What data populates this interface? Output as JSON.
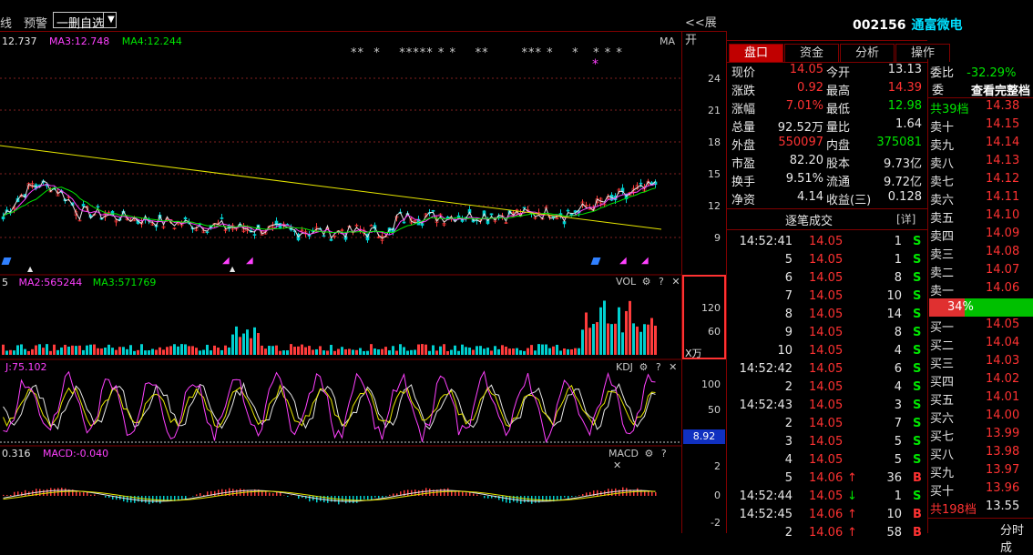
{
  "toolbar": {
    "line_tab": "线",
    "alert": "预警",
    "selector": "一删自选",
    "expand": "<<展开"
  },
  "main_chart": {
    "ma_values": [
      {
        "label": "12.737",
        "color": "#e6e6e6"
      },
      {
        "label": "MA3:12.748",
        "color": "#ff40ff"
      },
      {
        "label": "MA4:12.244",
        "color": "#00e600"
      }
    ],
    "ma_tag": "MA",
    "price_axis": [
      "24",
      "21",
      "18",
      "15",
      "12",
      "9"
    ],
    "price_ticks": [
      24,
      21,
      18,
      15,
      12,
      9
    ],
    "star_marks": "**  *    ***** * *    **       *** *    *   * * *",
    "star_accent": "*"
  },
  "vol_chart": {
    "labels": [
      {
        "label": "5",
        "color": "#e6e6e6"
      },
      {
        "label": "MA2:565244",
        "color": "#ff40ff"
      },
      {
        "label": "MA3:571769",
        "color": "#00e600"
      }
    ],
    "tag": "VOL",
    "axis": [
      "120",
      "60"
    ],
    "unit": "X万"
  },
  "kdj_chart": {
    "labels": [
      {
        "label": "J:75.102",
        "color": "#ff40ff"
      }
    ],
    "tag": "KDJ",
    "axis": [
      "100",
      "50"
    ],
    "current": "8.92"
  },
  "macd_chart": {
    "labels": [
      {
        "label": "0.316",
        "color": "#e6e6e6"
      },
      {
        "label": "MACD:-0.040",
        "color": "#ff40ff"
      }
    ],
    "tag": "MACD",
    "axis": [
      "2",
      "0",
      "-2"
    ]
  },
  "pane_tools": {
    "gear": "⚙",
    "help": "?",
    "close": "✕"
  },
  "stock": {
    "code": "002156",
    "name": "通富微电"
  },
  "tabs": [
    "盘口",
    "资金",
    "分析",
    "操作"
  ],
  "quote": [
    {
      "l1": "现价",
      "v1": "14.05",
      "c1": "red",
      "l2": "今开",
      "v2": "13.13",
      "c2": "white"
    },
    {
      "l1": "涨跌",
      "v1": "0.92",
      "c1": "red",
      "l2": "最高",
      "v2": "14.39",
      "c2": "red"
    },
    {
      "l1": "涨幅",
      "v1": "7.01%",
      "c1": "red",
      "l2": "最低",
      "v2": "12.98",
      "c2": "green"
    },
    {
      "l1": "总量",
      "v1": "92.52万",
      "c1": "white",
      "l2": "量比",
      "v2": "1.64",
      "c2": "white"
    },
    {
      "l1": "外盘",
      "v1": "550097",
      "c1": "red",
      "l2": "内盘",
      "v2": "375081",
      "c2": "green"
    },
    {
      "l1": "市盈",
      "v1": "82.20",
      "c1": "white",
      "l2": "股本",
      "v2": "9.73亿",
      "c2": "white"
    },
    {
      "l1": "换手",
      "v1": "9.51%",
      "c1": "white",
      "l2": "流通",
      "v2": "9.72亿",
      "c2": "white"
    },
    {
      "l1": "净资",
      "v1": "4.14",
      "c1": "white",
      "l2": "收益(三)",
      "v2": "0.128",
      "c2": "white"
    }
  ],
  "ticks": {
    "title": "逐笔成交",
    "detail": "[详]",
    "rows": [
      {
        "t": "14:52:41",
        "p": "14.05",
        "arrow": "",
        "v": "1",
        "s": "S"
      },
      {
        "t": "5",
        "p": "14.05",
        "arrow": "",
        "v": "1",
        "s": "S"
      },
      {
        "t": "6",
        "p": "14.05",
        "arrow": "",
        "v": "8",
        "s": "S"
      },
      {
        "t": "7",
        "p": "14.05",
        "arrow": "",
        "v": "10",
        "s": "S"
      },
      {
        "t": "8",
        "p": "14.05",
        "arrow": "",
        "v": "14",
        "s": "S"
      },
      {
        "t": "9",
        "p": "14.05",
        "arrow": "",
        "v": "8",
        "s": "S"
      },
      {
        "t": "10",
        "p": "14.05",
        "arrow": "",
        "v": "4",
        "s": "S"
      },
      {
        "t": "14:52:42",
        "p": "14.05",
        "arrow": "",
        "v": "6",
        "s": "S"
      },
      {
        "t": "2",
        "p": "14.05",
        "arrow": "",
        "v": "4",
        "s": "S"
      },
      {
        "t": "14:52:43",
        "p": "14.05",
        "arrow": "",
        "v": "3",
        "s": "S"
      },
      {
        "t": "2",
        "p": "14.05",
        "arrow": "",
        "v": "7",
        "s": "S"
      },
      {
        "t": "3",
        "p": "14.05",
        "arrow": "",
        "v": "5",
        "s": "S"
      },
      {
        "t": "4",
        "p": "14.05",
        "arrow": "",
        "v": "5",
        "s": "S"
      },
      {
        "t": "5",
        "p": "14.06",
        "arrow": "↑",
        "v": "36",
        "s": "B"
      },
      {
        "t": "14:52:44",
        "p": "14.05",
        "arrow": "↓",
        "v": "1",
        "s": "S"
      },
      {
        "t": "14:52:45",
        "p": "14.06",
        "arrow": "↑",
        "v": "10",
        "s": "B"
      },
      {
        "t": "2",
        "p": "14.06",
        "arrow": "↑",
        "v": "58",
        "s": "B"
      }
    ]
  },
  "orderbook": {
    "ratio_label": "委比",
    "ratio_value": "-32.29%",
    "ratio_suffix": "委",
    "full_link": "查看完整档",
    "top_label": "共39档",
    "top_price": "14.38",
    "sells": [
      {
        "l": "卖十",
        "p": "14.15"
      },
      {
        "l": "卖九",
        "p": "14.14"
      },
      {
        "l": "卖八",
        "p": "14.13"
      },
      {
        "l": "卖七",
        "p": "14.12"
      },
      {
        "l": "卖六",
        "p": "14.11"
      },
      {
        "l": "卖五",
        "p": "14.10"
      },
      {
        "l": "卖四",
        "p": "14.09"
      },
      {
        "l": "卖三",
        "p": "14.08"
      },
      {
        "l": "卖二",
        "p": "14.07"
      },
      {
        "l": "卖一",
        "p": "14.06"
      }
    ],
    "buy_pct": "34%",
    "buy_fraction": 0.34,
    "buys": [
      {
        "l": "买一",
        "p": "14.05"
      },
      {
        "l": "买二",
        "p": "14.04"
      },
      {
        "l": "买三",
        "p": "14.03"
      },
      {
        "l": "买四",
        "p": "14.02"
      },
      {
        "l": "买五",
        "p": "14.01"
      },
      {
        "l": "买六",
        "p": "14.00"
      },
      {
        "l": "买七",
        "p": "13.99"
      },
      {
        "l": "买八",
        "p": "13.98"
      },
      {
        "l": "买九",
        "p": "13.97"
      },
      {
        "l": "买十",
        "p": "13.96"
      }
    ],
    "bottom_label": "共198档",
    "bottom_price": "13.55",
    "footer": "分时成"
  }
}
